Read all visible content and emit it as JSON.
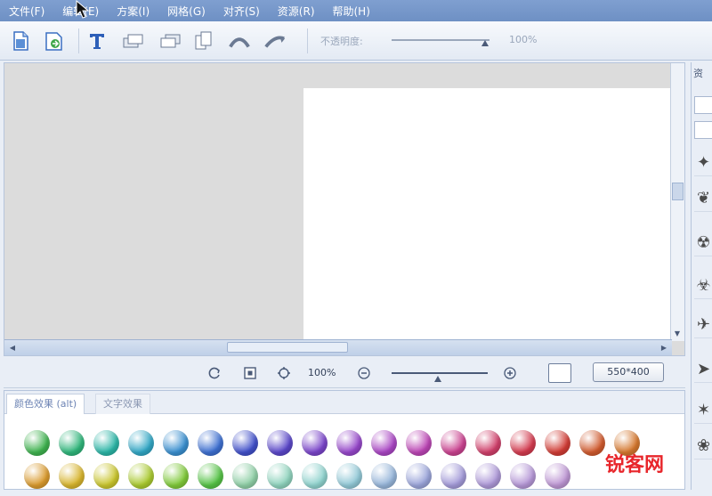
{
  "menu": [
    "文件(F)",
    "编辑(E)",
    "方案(I)",
    "网格(G)",
    "对齐(S)",
    "资源(R)",
    "帮助(H)"
  ],
  "toolbar": {
    "buttons": [
      "new-file-icon",
      "open-file-icon",
      "text-icon",
      "bring-forward-icon",
      "send-backward-icon",
      "copy-icon",
      "arc-up-icon",
      "arc-down-icon"
    ],
    "opacity_label": "不透明度:",
    "opacity_value": "100%",
    "opacity_level": 1.0
  },
  "status": {
    "zoom_value": "100%",
    "canvas_size": "550*400"
  },
  "effects": {
    "tabs": [
      "颜色效果 (alt)",
      "文字效果"
    ],
    "row1": [
      "#3fb24f",
      "#2fb57a",
      "#2bb5a6",
      "#31a6c4",
      "#3a8fcf",
      "#3d6fd0",
      "#4150c9",
      "#5a47c8",
      "#7a45c9",
      "#9547c9",
      "#a946c3",
      "#bb45b4",
      "#c9428f",
      "#cf3f6a",
      "#d23a4e",
      "#d03c35",
      "#cf5a2e",
      "#d4772e"
    ],
    "row2": [
      "#d99a2e",
      "#d7b42d",
      "#c9c52d",
      "#a9c92f",
      "#7fc93a",
      "#55c246",
      "#8fcfa6",
      "#8fd3bd",
      "#8fd2cd",
      "#91c8d6",
      "#96b5d9",
      "#9aa4d9",
      "#a39ad8",
      "#ad98d7",
      "#b597d6",
      "#bd96d3"
    ]
  },
  "right_panel": {
    "tab_label": "资"
  },
  "watermark": "锐客网"
}
